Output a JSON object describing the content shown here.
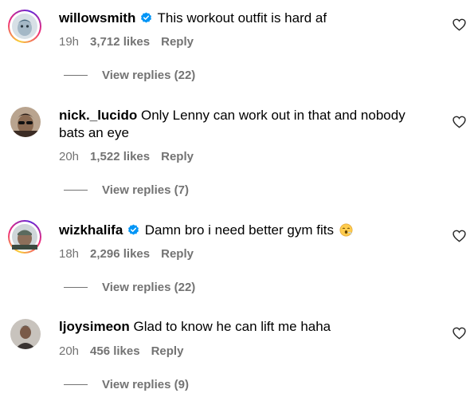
{
  "comments": [
    {
      "username": "willowsmith",
      "verified": true,
      "text": "This workout outfit is hard af",
      "time": "19h",
      "likes": "3,712 likes",
      "reply_label": "Reply",
      "view_replies": "View replies (22)"
    },
    {
      "username": "nick._lucido",
      "verified": false,
      "text": "Only Lenny can work out in that and nobody bats an eye",
      "time": "20h",
      "likes": "1,522 likes",
      "reply_label": "Reply",
      "view_replies": "View replies (7)"
    },
    {
      "username": "wizkhalifa",
      "verified": true,
      "text": "Damn bro i need better gym fits",
      "emoji": "😮‍💨",
      "time": "18h",
      "likes": "2,296 likes",
      "reply_label": "Reply",
      "view_replies": "View replies (22)"
    },
    {
      "username": "ljoysimeon",
      "verified": false,
      "text": "Glad to know he can lift me haha",
      "time": "20h",
      "likes": "456 likes",
      "reply_label": "Reply",
      "view_replies": "View replies (9)"
    }
  ],
  "icons": {
    "verified": "verified-badge-icon",
    "like": "heart-outline-icon"
  },
  "colors": {
    "text": "#000000",
    "meta": "#737373",
    "verified": "#0095f6"
  }
}
